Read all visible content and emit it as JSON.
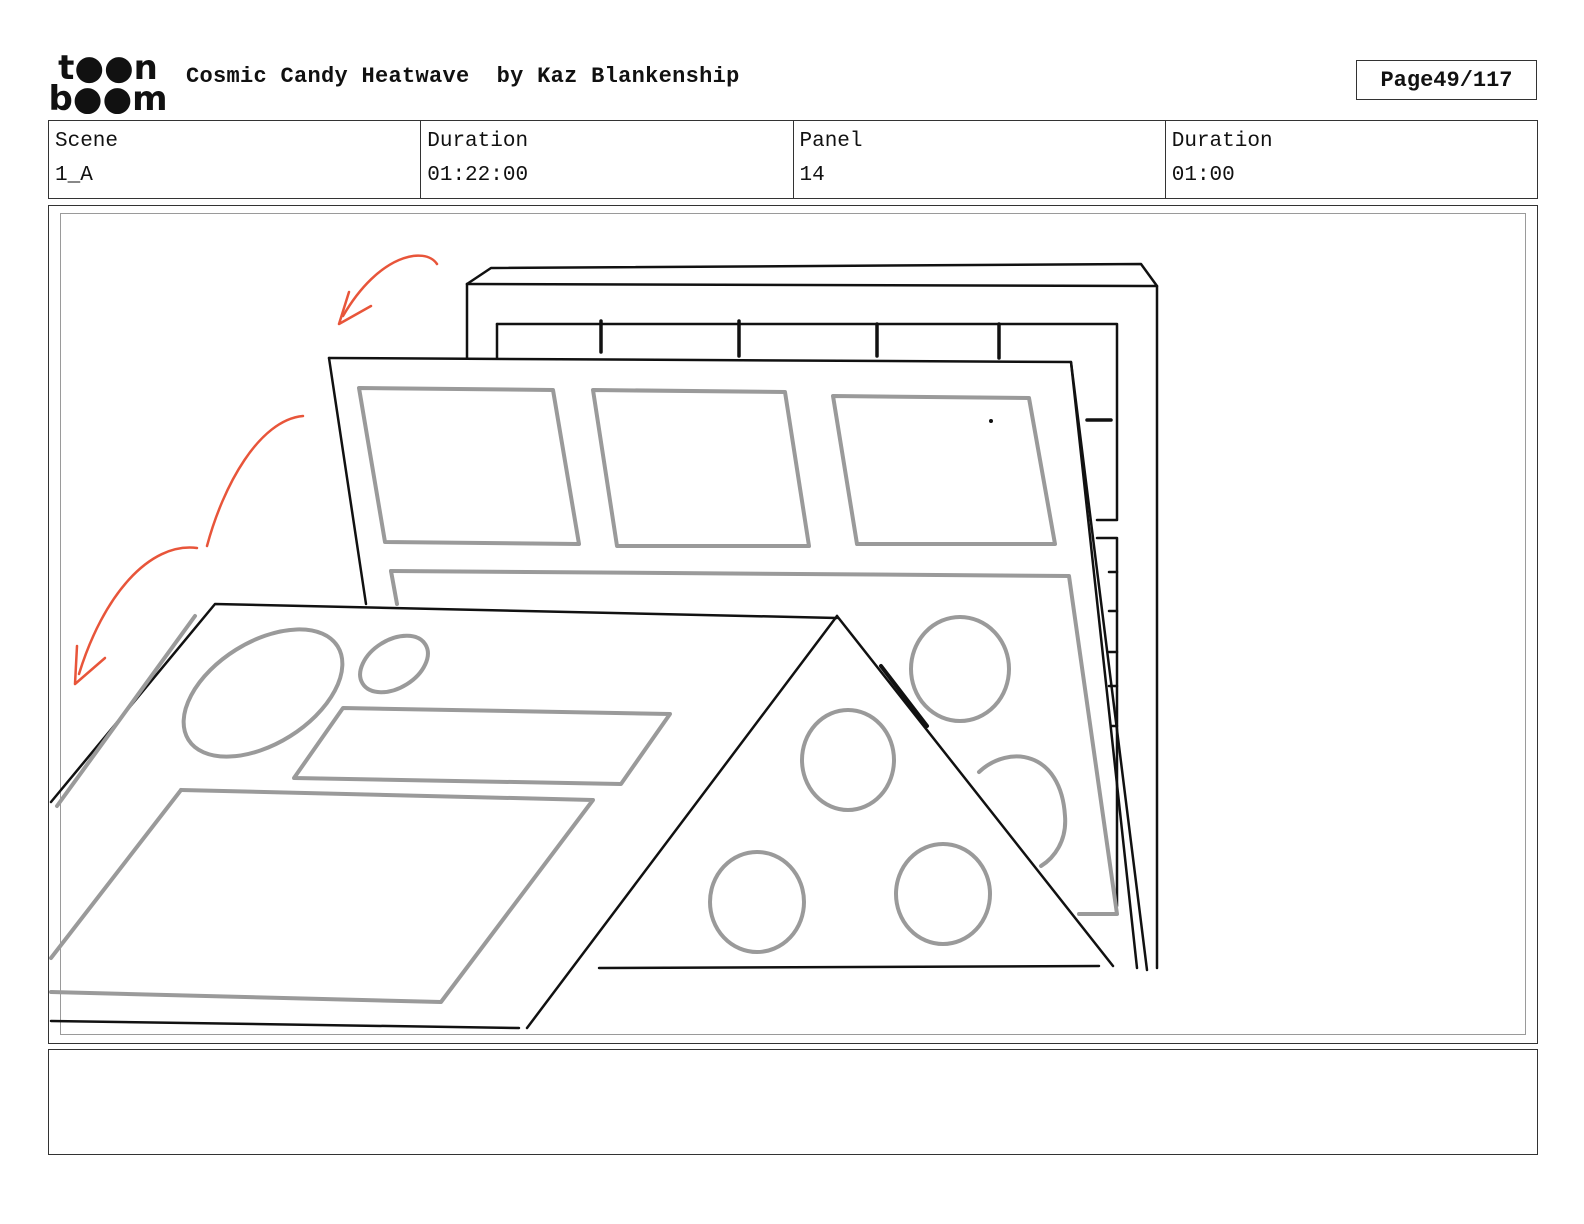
{
  "header": {
    "logo": {
      "icon": "toonboom-logo",
      "text": "toon boom"
    },
    "project_title": "Cosmic Candy Heatwave",
    "author": "by Kaz Blankenship",
    "page_label": "Page",
    "page_number": "49/117"
  },
  "info": {
    "scene_label": "Scene",
    "scene_value": "1_A",
    "scene_duration_label": "Duration",
    "scene_duration_value": "01:22:00",
    "panel_label": "Panel",
    "panel_value": "14",
    "panel_duration_label": "Duration",
    "panel_duration_value": "01:00"
  },
  "panel_image": {
    "icon": "storyboard-sketch",
    "colors": {
      "ink": "#111111",
      "shape": "#9a9a9a",
      "arrow": "#e8553a"
    }
  },
  "notes": {
    "text": ""
  }
}
